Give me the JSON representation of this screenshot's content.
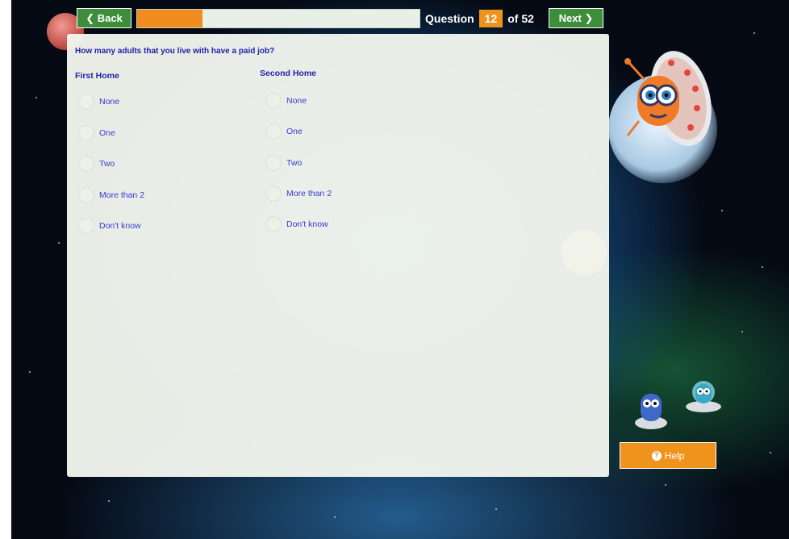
{
  "nav": {
    "back_label": "❮ Back",
    "next_label": "Next ❯",
    "progress_fraction": 0.23,
    "question_word": "Question",
    "question_number": "12",
    "question_total": "of 52"
  },
  "question": {
    "text": "How many adults that you live with have a paid job?",
    "columns": [
      {
        "heading": "First Home",
        "options": [
          "None",
          "One",
          "Two",
          "More than 2",
          "Don't know"
        ]
      },
      {
        "heading": "Second Home",
        "options": [
          "None",
          "One",
          "Two",
          "More than 2",
          "Don't know"
        ]
      }
    ]
  },
  "help": {
    "label": "Help",
    "icon": "question-circle-icon"
  },
  "colors": {
    "green": "#3d8d3b",
    "orange": "#f0931d",
    "question_text": "#2222aa",
    "option_text": "#3a3ad0"
  }
}
